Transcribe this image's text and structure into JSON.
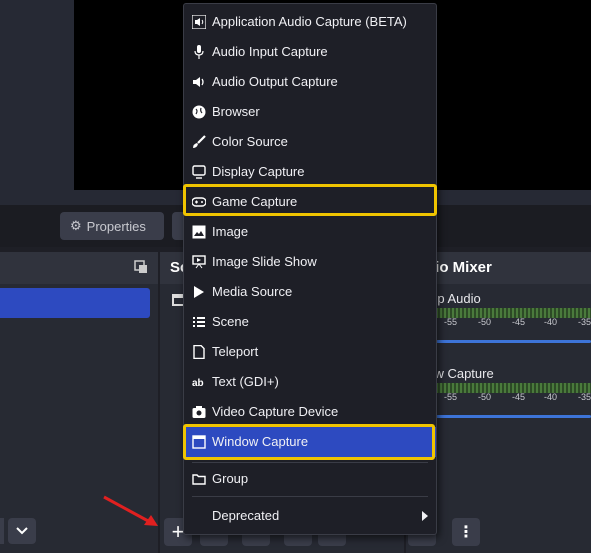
{
  "properties_button": {
    "label": "Properties",
    "icon": "gear-icon"
  },
  "sources_dock": {
    "title": "Sc"
  },
  "audio_mixer": {
    "title": "dio Mixer",
    "channels": [
      {
        "name": "ktop Audio",
        "ticks": [
          "-55",
          "-50",
          "-45",
          "-40",
          "-35"
        ]
      },
      {
        "name": "dow Capture",
        "ticks": [
          "-55",
          "-50",
          "-45",
          "-40",
          "-35"
        ]
      }
    ]
  },
  "add_source_menu": {
    "items": [
      {
        "label": "Application Audio Capture (BETA)",
        "icon": "speaker-icon"
      },
      {
        "label": "Audio Input Capture",
        "icon": "microphone-icon"
      },
      {
        "label": "Audio Output Capture",
        "icon": "speaker-icon"
      },
      {
        "label": "Browser",
        "icon": "globe-icon"
      },
      {
        "label": "Color Source",
        "icon": "paintbrush-icon"
      },
      {
        "label": "Display Capture",
        "icon": "monitor-icon"
      },
      {
        "label": "Game Capture",
        "icon": "gamepad-icon",
        "highlighted": true
      },
      {
        "label": "Image",
        "icon": "image-icon"
      },
      {
        "label": "Image Slide Show",
        "icon": "slideshow-icon"
      },
      {
        "label": "Media Source",
        "icon": "play-icon"
      },
      {
        "label": "Scene",
        "icon": "list-icon"
      },
      {
        "label": "Teleport",
        "icon": "document-icon"
      },
      {
        "label": "Text (GDI+)",
        "icon": "text-icon"
      },
      {
        "label": "Video Capture Device",
        "icon": "camera-icon"
      },
      {
        "label": "Window Capture",
        "icon": "window-icon",
        "selected": true,
        "highlighted": true
      },
      {
        "label": "Group",
        "icon": "folder-icon"
      },
      {
        "label": "Deprecated",
        "icon": "chevron-right-icon"
      }
    ]
  },
  "colors": {
    "selection": "#2d4ac0",
    "highlight_box": "#f0c400",
    "arrow": "#e02020"
  }
}
